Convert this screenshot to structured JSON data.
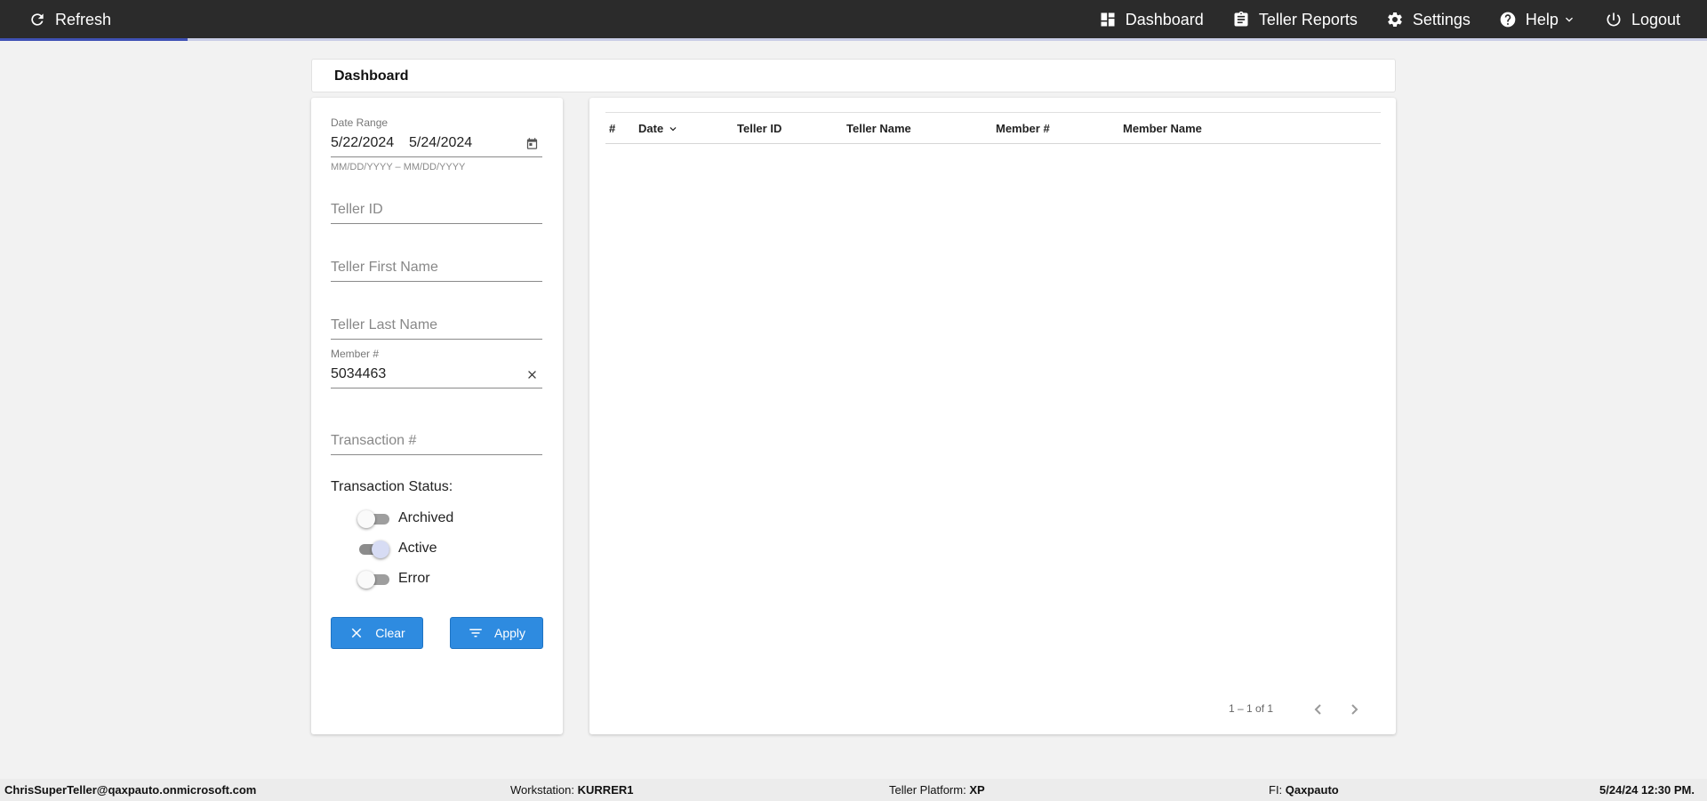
{
  "topbar": {
    "refresh_label": "Refresh",
    "nav": {
      "dashboard": "Dashboard",
      "teller_reports": "Teller Reports",
      "settings": "Settings",
      "help": "Help",
      "logout": "Logout"
    },
    "load_progress": 0.11
  },
  "page": {
    "title": "Dashboard"
  },
  "filters": {
    "date_range": {
      "label": "Date Range",
      "start": "5/22/2024",
      "end": "5/24/2024",
      "hint": "MM/DD/YYYY – MM/DD/YYYY"
    },
    "teller_id": {
      "placeholder": "Teller ID"
    },
    "teller_first_name": {
      "placeholder": "Teller First Name"
    },
    "teller_last_name": {
      "placeholder": "Teller Last Name"
    },
    "member_number": {
      "label": "Member #",
      "value": "5034463"
    },
    "transaction_number": {
      "placeholder": "Transaction #"
    },
    "transaction_status": {
      "label": "Transaction Status:",
      "options": [
        {
          "label": "Archived",
          "on": false
        },
        {
          "label": "Active",
          "on": true
        },
        {
          "label": "Error",
          "on": false
        }
      ]
    },
    "clear_label": "Clear",
    "apply_label": "Apply"
  },
  "table": {
    "columns": [
      "#",
      "Date",
      "Teller ID",
      "Teller Name",
      "Member #",
      "Member Name"
    ],
    "sort_column": "Date",
    "rows": [],
    "pagination": "1 – 1 of 1"
  },
  "footer": {
    "user": "ChrisSuperTeller@qaxpauto.onmicrosoft.com",
    "workstation_label": "Workstation:",
    "workstation": "KURRER1",
    "platform_label": "Teller Platform:",
    "platform": "XP",
    "fi_label": "FI:",
    "fi": "Qaxpauto",
    "datetime": "5/24/24 12:30 PM."
  },
  "colors": {
    "topbar": "#2b2b2b",
    "progress": "#3f51b5",
    "button": "#2e8be0",
    "background": "#f2f2f2"
  }
}
